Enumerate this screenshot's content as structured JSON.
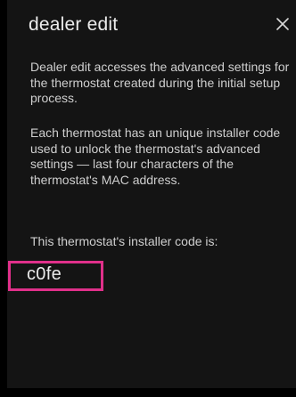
{
  "dialog": {
    "title": "dealer edit",
    "close_icon": "close-icon",
    "paragraph_1": "Dealer edit accesses the advanced settings for the thermostat created during the initial setup process.",
    "paragraph_2": "Each thermostat has an unique installer code used to unlock the thermostat's advanced settings — last four characters of the thermostat's MAC address.",
    "paragraph_3": "This thermostat's installer code is:",
    "installer_code": "c0fe"
  },
  "colors": {
    "background": "#000000",
    "panel": "#141414",
    "text": "#ececec",
    "body_text": "#cfcfcf",
    "highlight": "#e0308a"
  }
}
